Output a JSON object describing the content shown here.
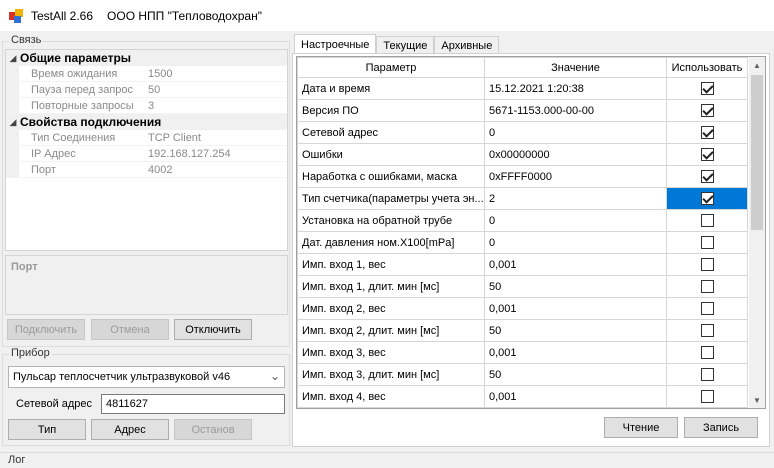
{
  "window": {
    "title": "TestAll 2.66",
    "company": "ООО НПП \"Тепловодохран\""
  },
  "connection": {
    "group_label": "Связь",
    "categories": [
      {
        "title": "Общие параметры",
        "rows": [
          {
            "key": "Время ожидания",
            "value": "1500"
          },
          {
            "key": "Пауза перед запрос",
            "value": "50"
          },
          {
            "key": "Повторные запросы",
            "value": "3"
          }
        ]
      },
      {
        "title": "Свойства подключения",
        "rows": [
          {
            "key": "Тип Соединения",
            "value": "TCP Client"
          },
          {
            "key": "IP Адрес",
            "value": "192.168.127.254"
          },
          {
            "key": "Порт",
            "value": "4002"
          }
        ]
      }
    ],
    "description_title": "Порт",
    "buttons": {
      "connect": "Подключить",
      "cancel": "Отмена",
      "disconnect": "Отключить"
    }
  },
  "device": {
    "group_label": "Прибор",
    "selected_device": "Пульсар теплосчетчик ультразвуковой v46",
    "network_address_label": "Сетевой адрес",
    "network_address_value": "4811627",
    "buttons": {
      "type": "Тип",
      "address": "Адрес",
      "stop": "Останов"
    }
  },
  "tabs": [
    "Настроечные",
    "Текущие",
    "Архивные"
  ],
  "grid": {
    "headers": {
      "param": "Параметр",
      "value": "Значение",
      "use": "Использовать"
    },
    "rows": [
      {
        "param": "Дата и время",
        "value": "15.12.2021 1:20:38",
        "use": true
      },
      {
        "param": "Версия ПО",
        "value": "5671-1153.000-00-00",
        "use": true
      },
      {
        "param": "Сетевой адрес",
        "value": "0",
        "use": true
      },
      {
        "param": "Ошибки",
        "value": "0x00000000",
        "use": true
      },
      {
        "param": "Наработка с ошибками, маска",
        "value": "0xFFFF0000",
        "use": true
      },
      {
        "param": "Тип счетчика(параметры учета эн...",
        "value": "2",
        "use": true,
        "selected": true
      },
      {
        "param": "Установка на обратной трубе",
        "value": "0",
        "use": false
      },
      {
        "param": "Дат. давления ном.X100[mPa]",
        "value": "0",
        "use": false
      },
      {
        "param": "Имп. вход 1, вес",
        "value": "0,001",
        "use": false
      },
      {
        "param": "Имп. вход 1, длит. мин [мс]",
        "value": "50",
        "use": false
      },
      {
        "param": "Имп. вход 2, вес",
        "value": "0,001",
        "use": false
      },
      {
        "param": "Имп. вход 2, длит. мин [мс]",
        "value": "50",
        "use": false
      },
      {
        "param": "Имп. вход 3, вес",
        "value": "0,001",
        "use": false
      },
      {
        "param": "Имп. вход 3, длит. мин [мс]",
        "value": "50",
        "use": false
      },
      {
        "param": "Имп. вход 4, вес",
        "value": "0,001",
        "use": false
      }
    ]
  },
  "actions": {
    "read": "Чтение",
    "write": "Запись"
  },
  "log": {
    "label": "Лог"
  },
  "colors": {
    "selection": "#0078d7",
    "window_bg": "#f0f0f0"
  }
}
